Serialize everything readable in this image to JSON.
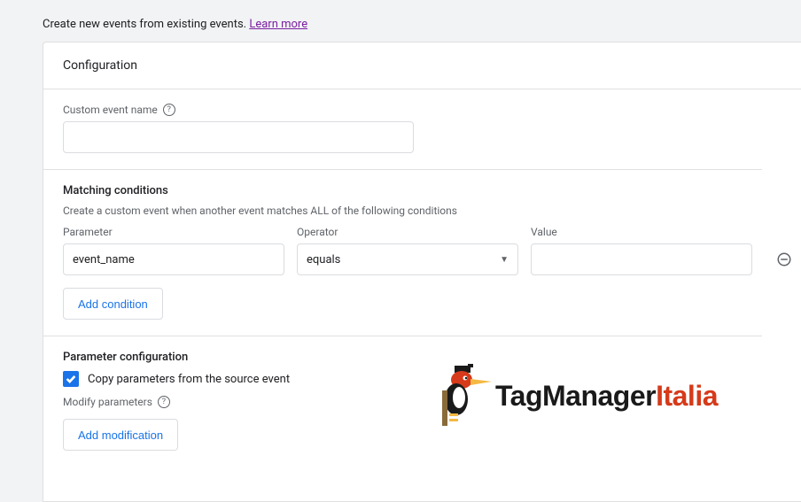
{
  "top": {
    "text": "Create new events from existing events. ",
    "link": "Learn more"
  },
  "config": {
    "title": "Configuration",
    "custom_event_label": "Custom event name",
    "custom_event_value": ""
  },
  "matching": {
    "title": "Matching conditions",
    "desc": "Create a custom event when another event matches ALL of the following conditions",
    "labels": {
      "param": "Parameter",
      "op": "Operator",
      "val": "Value"
    },
    "row": {
      "param": "event_name",
      "op": "equals",
      "val": ""
    },
    "add_btn": "Add condition"
  },
  "params": {
    "title": "Parameter configuration",
    "copy_label": "Copy parameters from the source event",
    "modify_label": "Modify parameters",
    "add_btn": "Add modification"
  },
  "logo": {
    "a": "TagManager",
    "b": "Italia"
  }
}
